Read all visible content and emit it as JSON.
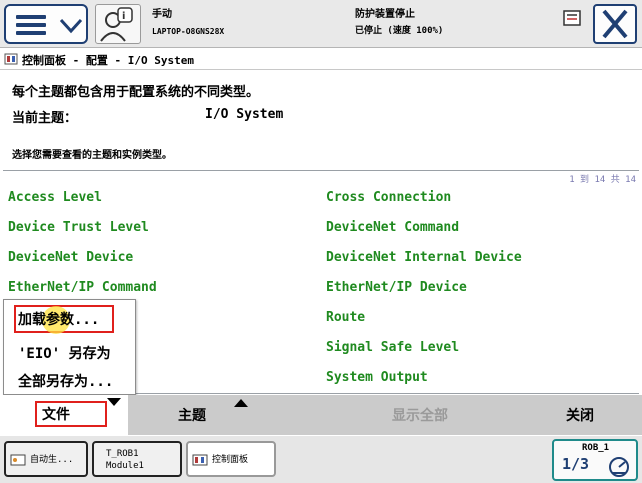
{
  "header": {
    "mode": "手动",
    "controller": "LAPTOP-O8GNS28X",
    "safety_state": "防护装置停止",
    "run_state": "已停止 (速度 100%)"
  },
  "breadcrumb": {
    "title": "控制面板 - 配置 - I/O System"
  },
  "description": {
    "line1": "每个主题都包含用于配置系统的不同类型。",
    "current_topic_label": "当前主题：",
    "current_topic_value": "I/O System",
    "instruction": "选择您需要查看的主题和实例类型。"
  },
  "list": {
    "pager": "1 到 14 共 14",
    "left_column": [
      "Access Level",
      "Device Trust Level",
      "DeviceNet Device",
      "EtherNet/IP Command",
      "Industrial Network",
      "",
      ""
    ],
    "right_column": [
      "Cross Connection",
      "DeviceNet Command",
      "DeviceNet Internal Device",
      "EtherNet/IP Device",
      "Route",
      "Signal Safe Level",
      "System Output"
    ],
    "visible_partial": "ork"
  },
  "popup_menu": {
    "items": [
      "加载参数...",
      "'EIO' 另存为",
      "全部另存为..."
    ]
  },
  "command_bar": {
    "file": "文件",
    "topic": "主题",
    "show_all": "显示全部",
    "close": "关闭"
  },
  "taskbar": {
    "task1": "自动生...",
    "task2_line1": "T_ROB1",
    "task2_line2": "Module1",
    "task3": "控制面板",
    "robot": "ROB_1",
    "fraction": "1/3"
  },
  "colors": {
    "accent_blue": "#1f3f73",
    "item_green": "#1f8a1f",
    "highlight_red": "#e0201c"
  }
}
